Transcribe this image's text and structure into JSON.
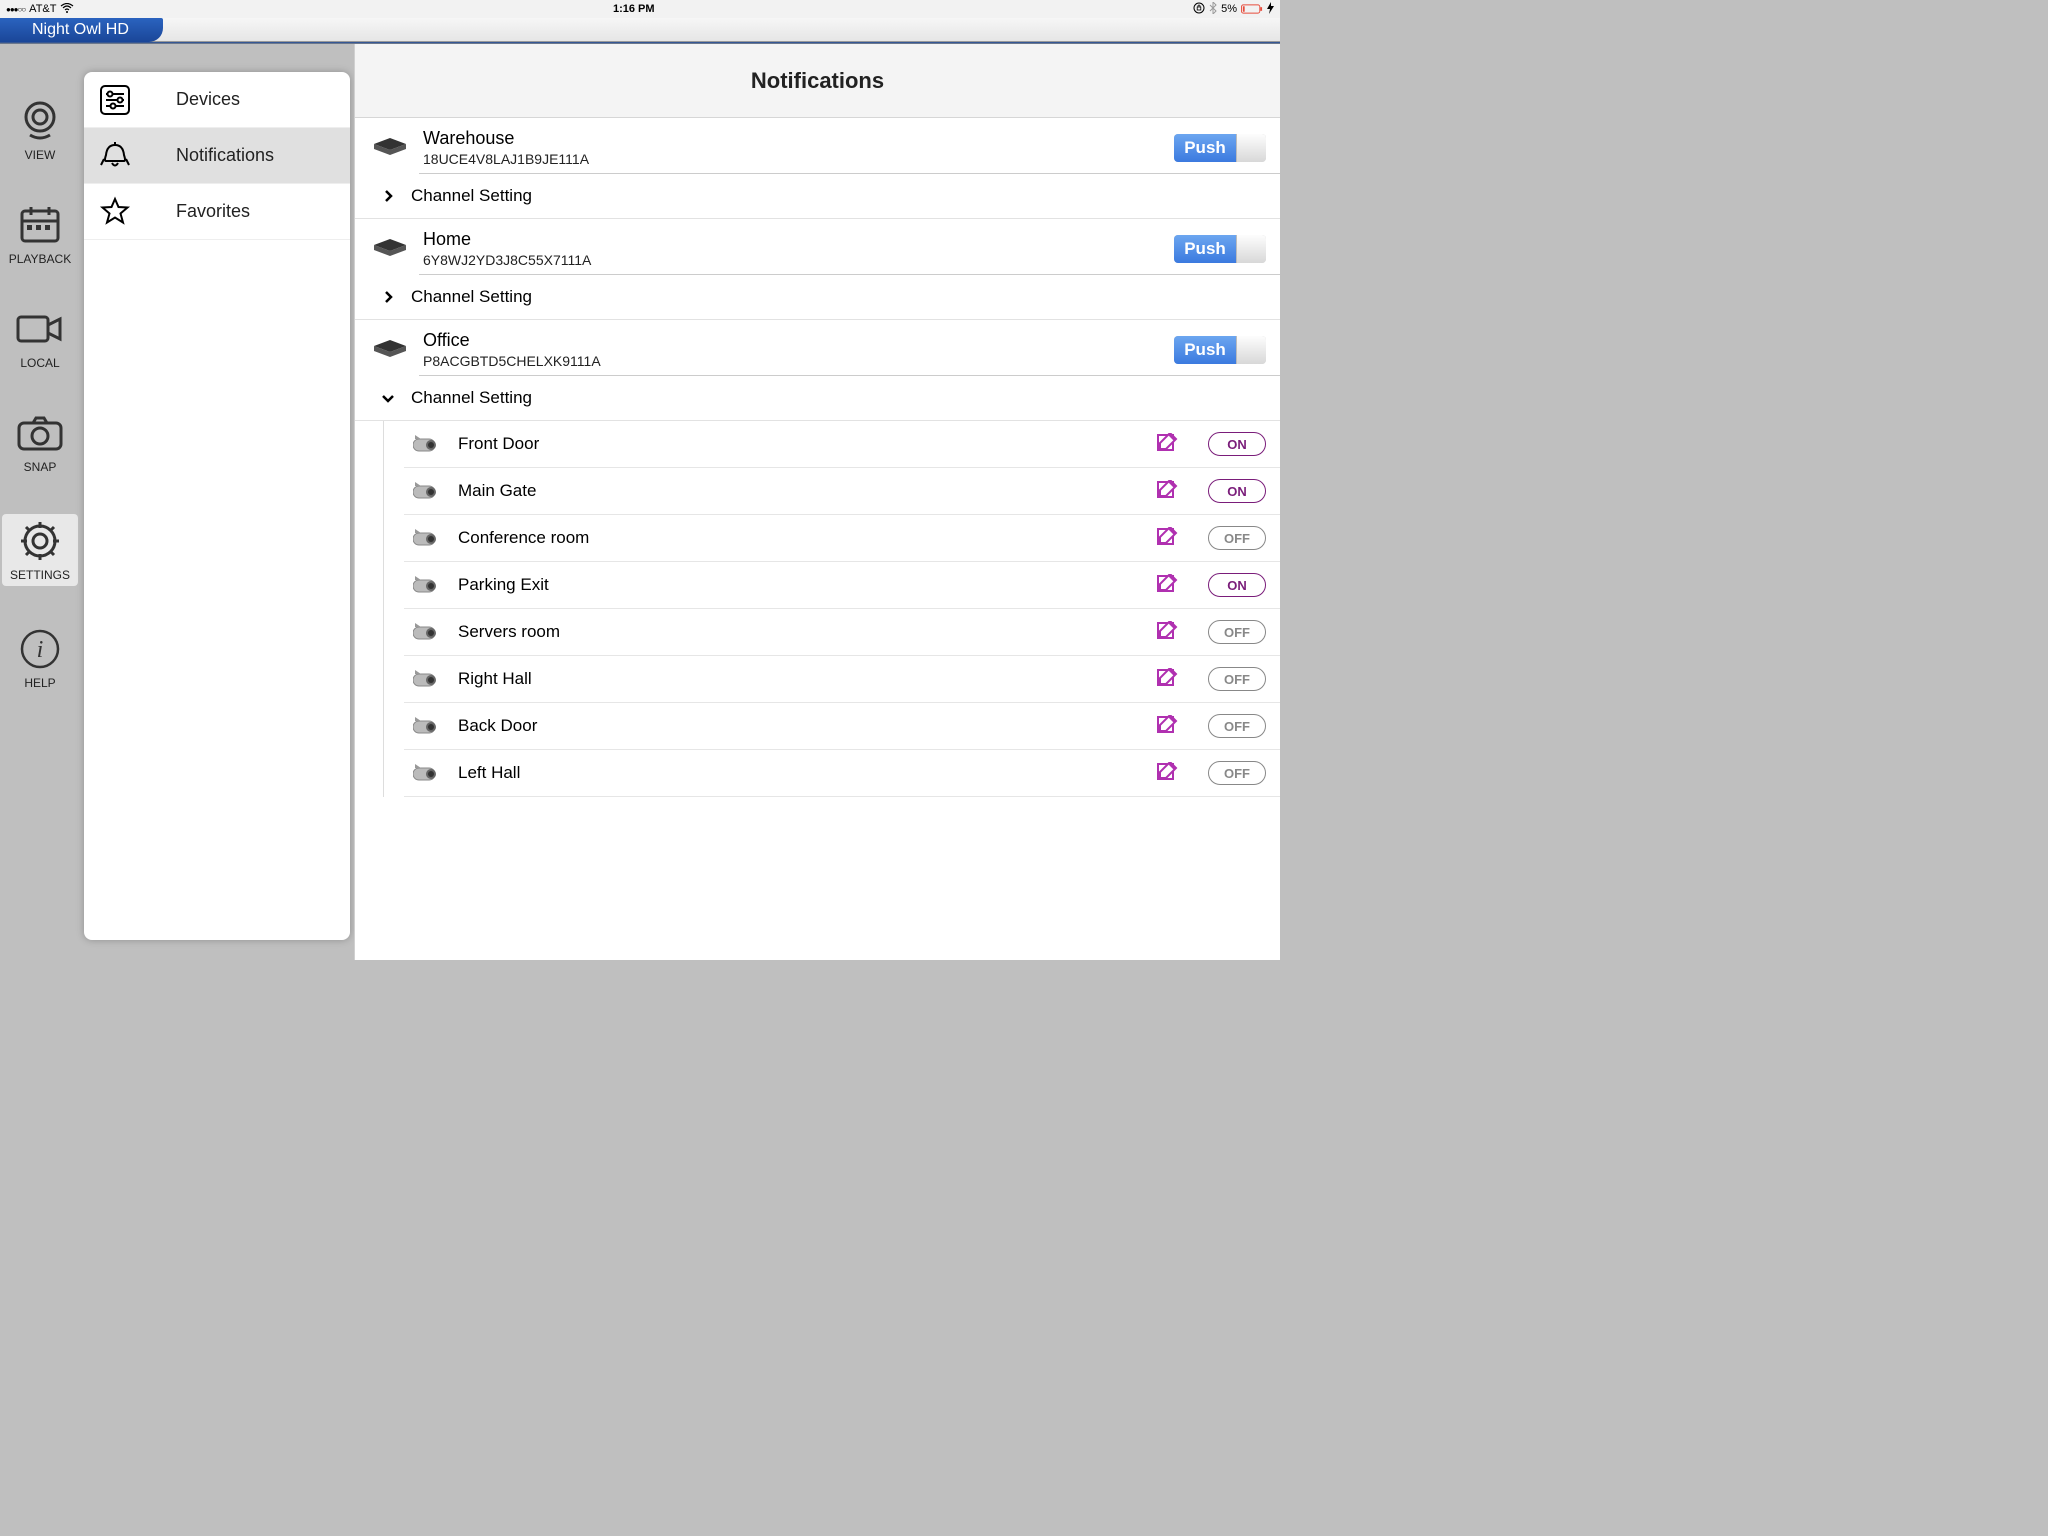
{
  "statusbar": {
    "carrier": "AT&T",
    "time": "1:16 PM",
    "battery": "5%"
  },
  "app": {
    "title": "Night Owl HD"
  },
  "leftnav": {
    "items": [
      {
        "label": "VIEW"
      },
      {
        "label": "PLAYBACK"
      },
      {
        "label": "LOCAL"
      },
      {
        "label": "SNAP"
      },
      {
        "label": "SETTINGS"
      },
      {
        "label": "HELP"
      }
    ]
  },
  "sidebar": {
    "items": [
      {
        "label": "Devices"
      },
      {
        "label": "Notifications"
      },
      {
        "label": "Favorites"
      }
    ]
  },
  "content": {
    "title": "Notifications",
    "push_label": "Push",
    "channel_setting_label": "Channel Setting",
    "devices": [
      {
        "name": "Warehouse",
        "id": "18UCE4V8LAJ1B9JE111A",
        "expanded": false
      },
      {
        "name": "Home",
        "id": "6Y8WJ2YD3J8C55X7111A",
        "expanded": false
      },
      {
        "name": "Office",
        "id": "P8ACGBTD5CHELXK9111A",
        "expanded": true,
        "channels": [
          {
            "name": "Front Door",
            "state": "ON"
          },
          {
            "name": "Main Gate",
            "state": "ON"
          },
          {
            "name": "Conference room",
            "state": "OFF"
          },
          {
            "name": "Parking Exit",
            "state": "ON"
          },
          {
            "name": "Servers room",
            "state": "OFF"
          },
          {
            "name": "Right Hall",
            "state": "OFF"
          },
          {
            "name": "Back Door",
            "state": "OFF"
          },
          {
            "name": "Left Hall",
            "state": "OFF"
          }
        ]
      }
    ]
  }
}
